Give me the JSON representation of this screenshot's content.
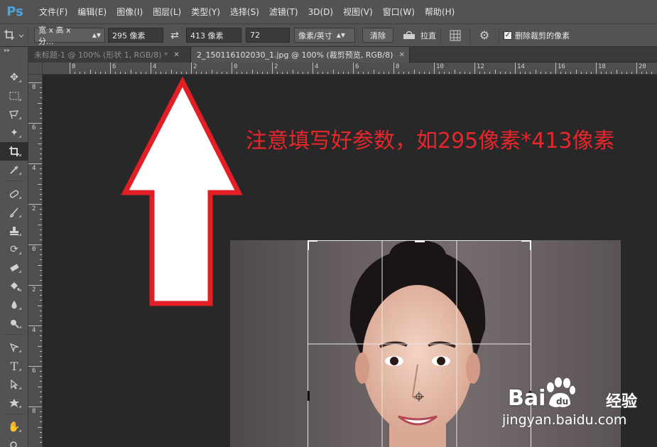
{
  "menubar": {
    "logo": "Ps",
    "items": [
      "文件(F)",
      "编辑(E)",
      "图像(I)",
      "图层(L)",
      "类型(Y)",
      "选择(S)",
      "滤镜(T)",
      "3D(D)",
      "视图(V)",
      "窗口(W)",
      "帮助(H)"
    ]
  },
  "options": {
    "ratio_preset": "宽 x 高 x 分...",
    "width": "295 像素",
    "height": "413 像素",
    "resolution": "72",
    "resolution_unit": "像素/英寸",
    "clear_label": "清除",
    "straighten_label": "拉直",
    "delete_cropped_label": "删除裁剪的像素"
  },
  "tabs": [
    {
      "label": "未标题-1 @ 100% (形状 1, RGB/8) *",
      "active": false
    },
    {
      "label": "2_150116102030_1.jpg @ 100% (裁剪预览, RGB/8)",
      "active": true
    }
  ],
  "ruler_top": [
    "8",
    "6",
    "4",
    "2",
    "0",
    "2",
    "4",
    "6",
    "8",
    "10",
    "12",
    "14",
    "16",
    "18",
    "20"
  ],
  "ruler_left": [
    "8",
    "6",
    "4",
    "2",
    "0",
    "2",
    "4",
    "6",
    "8"
  ],
  "annotation": "注意填写好参数，如295像素*413像素",
  "watermark": {
    "brand": "Bai",
    "brand_tail": "经验",
    "url": "jingyan.baidu.com"
  }
}
